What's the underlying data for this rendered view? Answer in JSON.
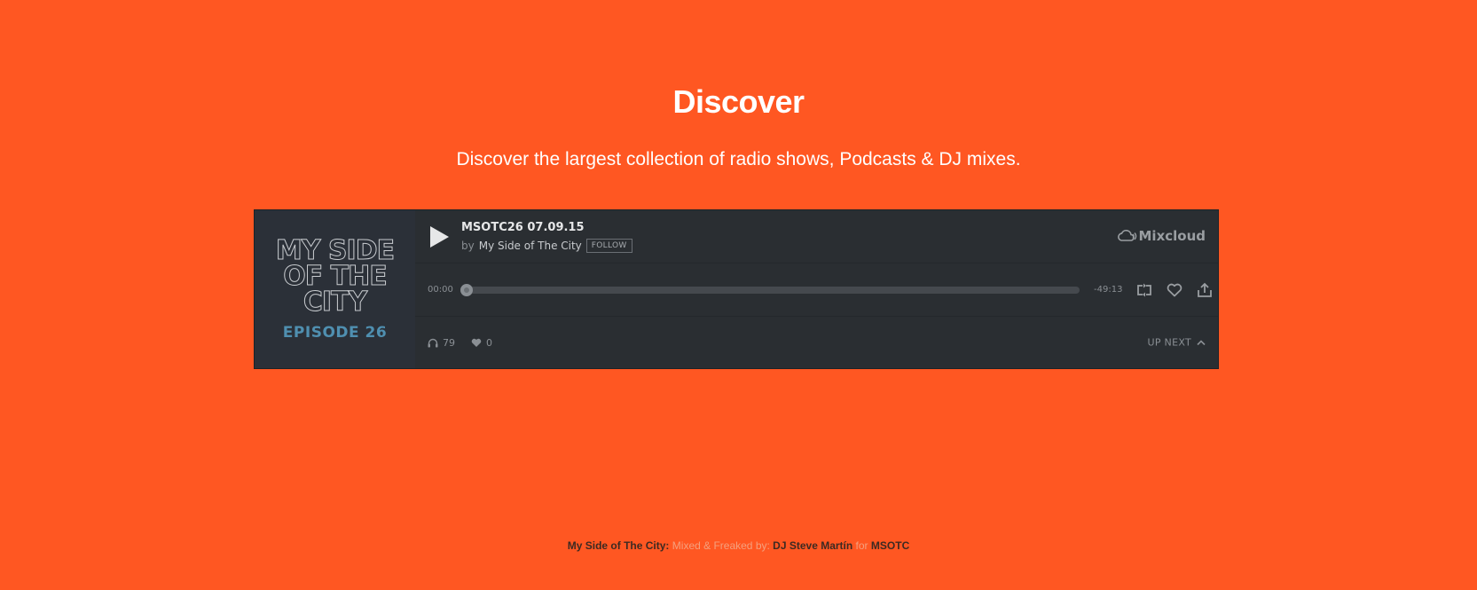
{
  "hero": {
    "title": "Discover",
    "subtitle": "Discover the largest collection of radio shows, Podcasts & DJ mixes."
  },
  "player": {
    "artwork": {
      "line1": "MY SIDE",
      "line2": "OF THE",
      "line3": "CITY",
      "episode": "EPISODE 26"
    },
    "track_title": "MSOTC26 07.09.15",
    "by_label": "by",
    "artist": "My Side of The City",
    "follow_label": "FOLLOW",
    "brand": "Mixcloud",
    "time_elapsed": "00:00",
    "time_remaining": "-49:13",
    "progress_fraction": 0,
    "plays": "79",
    "likes": "0",
    "up_next_label": "UP NEXT",
    "icons": {
      "play": "play-icon",
      "repost": "repost-icon",
      "favorite": "heart-icon",
      "share": "share-icon",
      "plays": "headphones-icon",
      "likes": "heart-icon",
      "up_next": "chevron-up-icon",
      "brand": "mixcloud-logo-icon"
    }
  },
  "footer": {
    "show_name": "My Side of The City:",
    "mixed_by_text": "Mixed & Freaked by:",
    "dj_name": "DJ Steve Martín",
    "for_text": "for",
    "label": "MSOTC"
  },
  "colors": {
    "background": "#ff5722",
    "player_bg": "#2a2e32",
    "accent_episode": "#4f8fb0"
  }
}
